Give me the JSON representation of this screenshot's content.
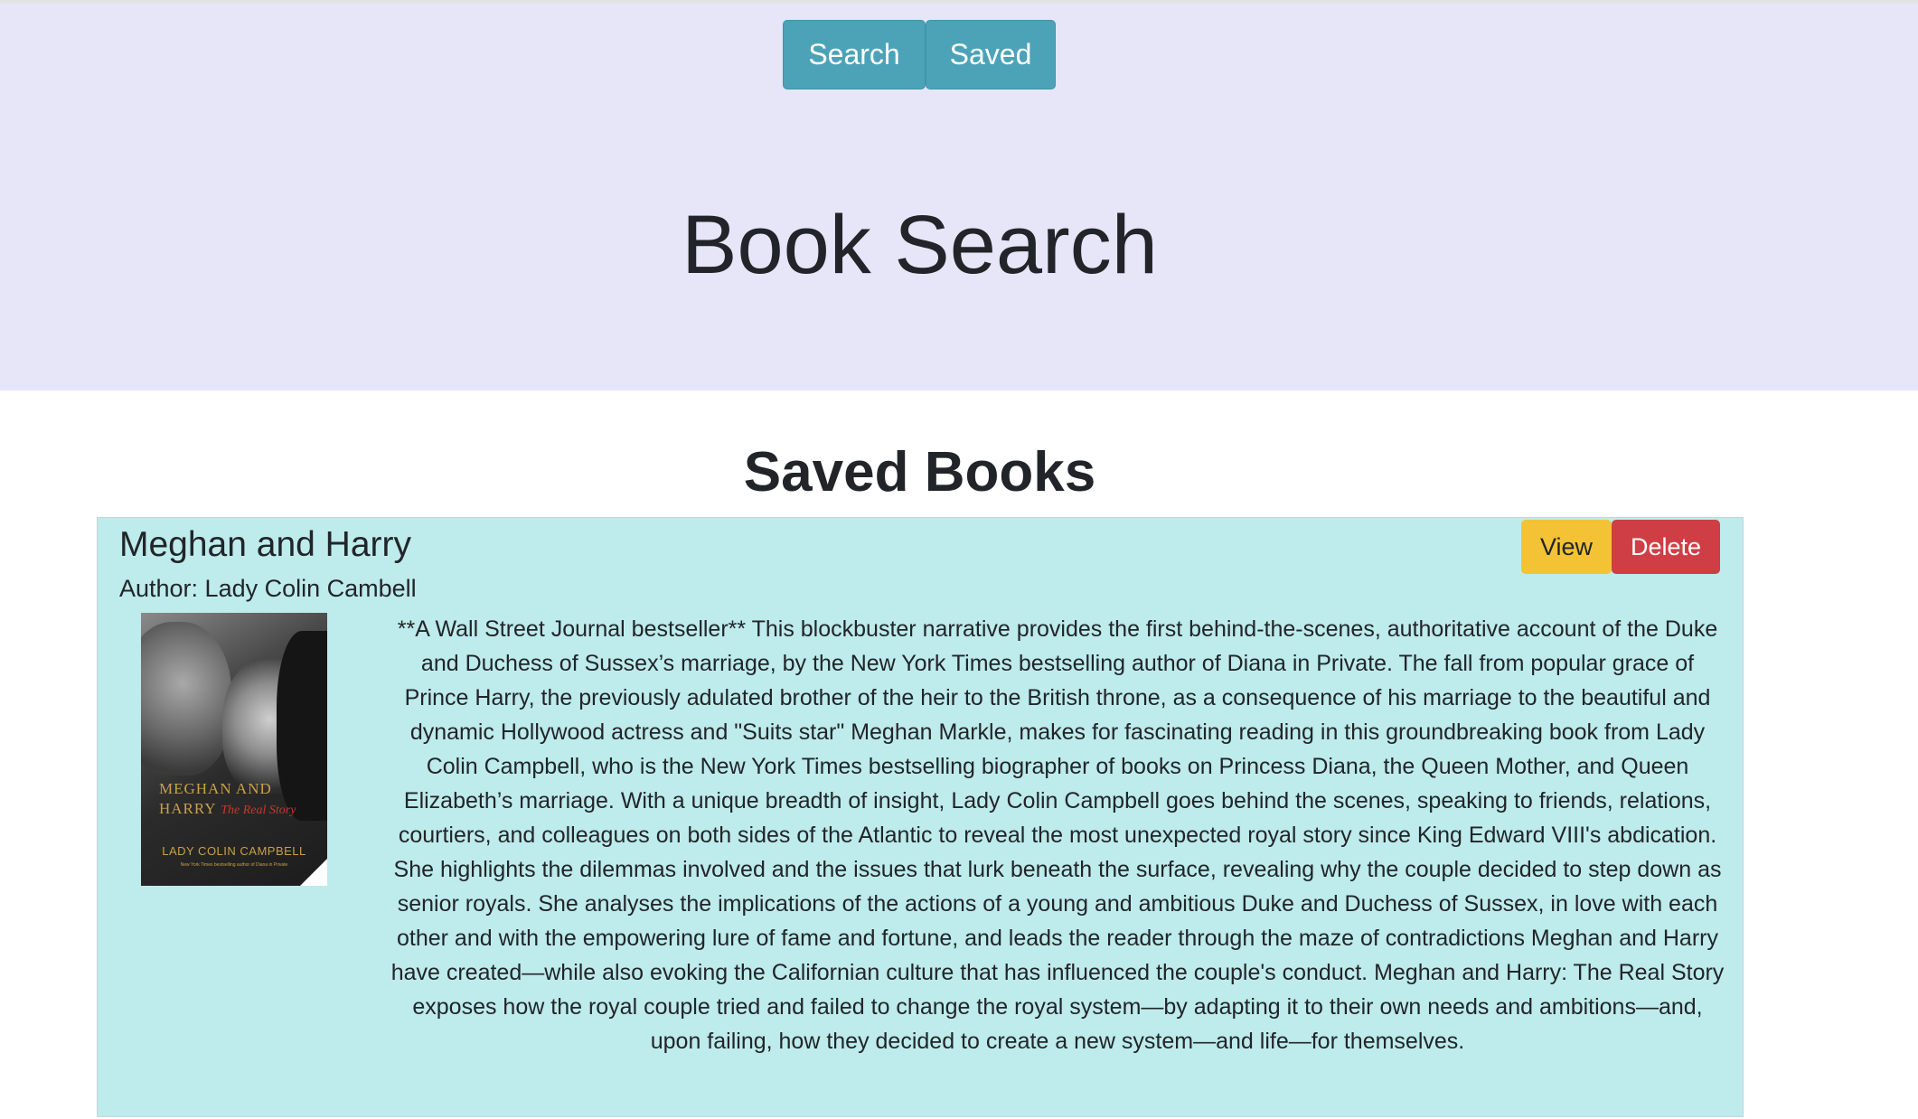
{
  "nav": {
    "search_label": "Search",
    "saved_label": "Saved"
  },
  "header": {
    "title": "Book Search"
  },
  "main": {
    "section_title": "Saved Books",
    "books": [
      {
        "title": "Meghan and Harry",
        "author": "Author: Lady Colin Cambell",
        "view_label": "View",
        "delete_label": "Delete",
        "cover": {
          "title_line": "MEGHAN AND HARRY",
          "subtitle": "The Real Story",
          "author": "LADY COLIN CAMPBELL",
          "tagline": "New York Times bestselling author of Diana in Private"
        },
        "description": "**A Wall Street Journal bestseller** This blockbuster narrative provides the first behind-the-scenes, authoritative account of the Duke and Duchess of Sussex’s marriage, by the New York Times bestselling author of Diana in Private. The fall from popular grace of Prince Harry, the previously adulated brother of the heir to the British throne, as a consequence of his marriage to the beautiful and dynamic Hollywood actress and \"Suits star\" Meghan Markle, makes for fascinating reading in this groundbreaking book from Lady Colin Campbell, who is the New York Times bestselling biographer of books on Princess Diana, the Queen Mother, and Queen Elizabeth’s marriage. With a unique breadth of insight, Lady Colin Campbell goes behind the scenes, speaking to friends, relations, courtiers, and colleagues on both sides of the Atlantic to reveal the most unexpected royal story since King Edward VIII's abdication. She highlights the dilemmas involved and the issues that lurk beneath the surface, revealing why the couple decided to step down as senior royals. She analyses the implications of the actions of a young and ambitious Duke and Duchess of Sussex, in love with each other and with the empowering lure of fame and fortune, and leads the reader through the maze of contradictions Meghan and Harry have created—while also evoking the Californian culture that has influenced the couple's conduct. Meghan and Harry: The Real Story exposes how the royal couple tried and failed to change the royal system—by adapting it to their own needs and ambitions—and, upon failing, how they decided to create a new system—and life—for themselves."
      }
    ]
  },
  "colors": {
    "header_bg": "#e6e6f8",
    "nav_button": "#4ca3b8",
    "card_bg": "#beebec",
    "view_button": "#f4c235",
    "delete_button": "#d03e45"
  }
}
